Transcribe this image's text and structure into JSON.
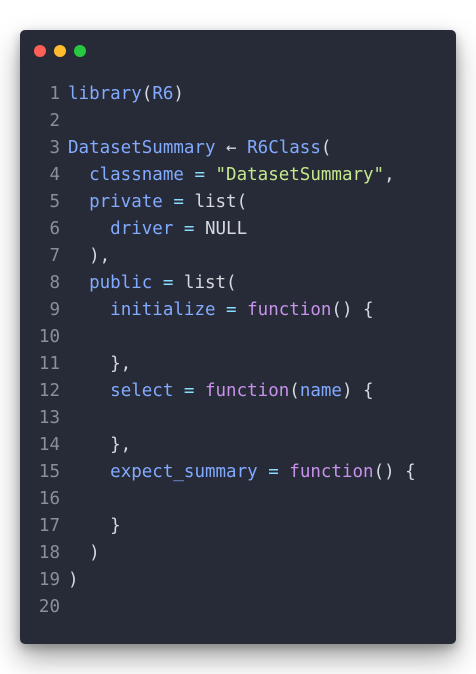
{
  "window": {
    "controls": [
      {
        "name": "close",
        "color": "#ff5f57"
      },
      {
        "name": "minimize",
        "color": "#febc2e"
      },
      {
        "name": "maximize",
        "color": "#28c840"
      }
    ]
  },
  "colors": {
    "background": "#272b37",
    "plain": "#d6d9e0",
    "function": "#82aaff",
    "keyword": "#c792ea",
    "string": "#c3e88d",
    "operator": "#89ddff",
    "line_number": "#8a8f9b"
  },
  "code_lines": [
    {
      "n": "1",
      "tokens": [
        [
          "library",
          "func"
        ],
        [
          "(",
          "plain"
        ],
        [
          "R6",
          "func"
        ],
        [
          ")",
          "plain"
        ]
      ]
    },
    {
      "n": "2",
      "tokens": []
    },
    {
      "n": "3",
      "tokens": [
        [
          "DatasetSummary",
          "func"
        ],
        [
          " ← ",
          "plain"
        ],
        [
          "R6Class",
          "func"
        ],
        [
          "(",
          "plain"
        ]
      ]
    },
    {
      "n": "4",
      "tokens": [
        [
          "  ",
          "plain"
        ],
        [
          "classname",
          "func"
        ],
        [
          " = ",
          "op"
        ],
        [
          "\"DatasetSummary\"",
          "str"
        ],
        [
          ",",
          "plain"
        ]
      ]
    },
    {
      "n": "5",
      "tokens": [
        [
          "  ",
          "plain"
        ],
        [
          "private",
          "func"
        ],
        [
          " = ",
          "op"
        ],
        [
          "list(",
          "plain"
        ]
      ]
    },
    {
      "n": "6",
      "tokens": [
        [
          "    ",
          "plain"
        ],
        [
          "driver",
          "func"
        ],
        [
          " = ",
          "op"
        ],
        [
          "NULL",
          "plain"
        ]
      ]
    },
    {
      "n": "7",
      "tokens": [
        [
          "  ),",
          "plain"
        ]
      ]
    },
    {
      "n": "8",
      "tokens": [
        [
          "  ",
          "plain"
        ],
        [
          "public",
          "func"
        ],
        [
          " = ",
          "op"
        ],
        [
          "list(",
          "plain"
        ]
      ]
    },
    {
      "n": "9",
      "tokens": [
        [
          "    ",
          "plain"
        ],
        [
          "initialize",
          "func"
        ],
        [
          " = ",
          "op"
        ],
        [
          "function",
          "kw"
        ],
        [
          "() {",
          "plain"
        ]
      ]
    },
    {
      "n": "10",
      "tokens": []
    },
    {
      "n": "11",
      "tokens": [
        [
          "    },",
          "plain"
        ]
      ]
    },
    {
      "n": "12",
      "tokens": [
        [
          "    ",
          "plain"
        ],
        [
          "select",
          "func"
        ],
        [
          " = ",
          "op"
        ],
        [
          "function",
          "kw"
        ],
        [
          "(",
          "plain"
        ],
        [
          "name",
          "func"
        ],
        [
          ") {",
          "plain"
        ]
      ]
    },
    {
      "n": "13",
      "tokens": []
    },
    {
      "n": "14",
      "tokens": [
        [
          "    },",
          "plain"
        ]
      ]
    },
    {
      "n": "15",
      "tokens": [
        [
          "    ",
          "plain"
        ],
        [
          "expect_summary",
          "func"
        ],
        [
          " = ",
          "op"
        ],
        [
          "function",
          "kw"
        ],
        [
          "() {",
          "plain"
        ]
      ]
    },
    {
      "n": "16",
      "tokens": []
    },
    {
      "n": "17",
      "tokens": [
        [
          "    }",
          "plain"
        ]
      ]
    },
    {
      "n": "18",
      "tokens": [
        [
          "  )",
          "plain"
        ]
      ]
    },
    {
      "n": "19",
      "tokens": [
        [
          ")",
          "plain"
        ]
      ]
    },
    {
      "n": "20",
      "tokens": []
    }
  ]
}
